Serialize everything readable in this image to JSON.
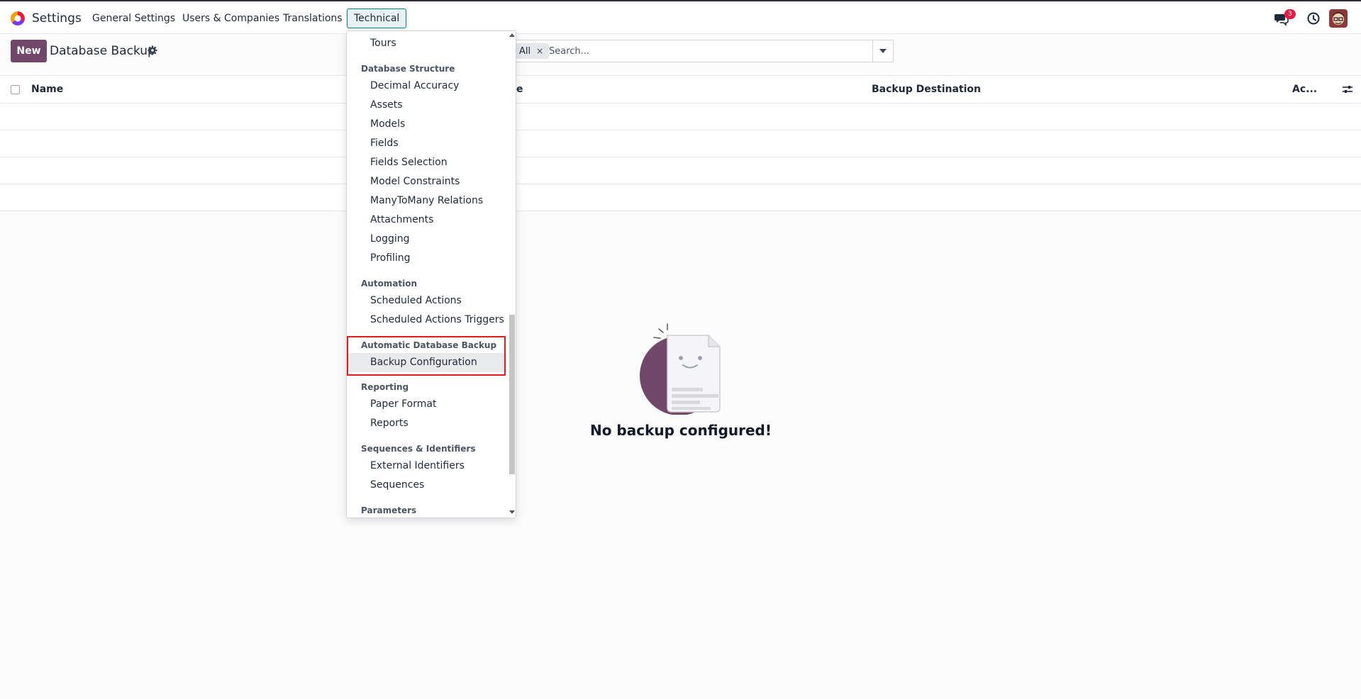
{
  "navbar": {
    "app_title": "Settings",
    "menus": [
      {
        "label": "General Settings"
      },
      {
        "label": "Users & Companies"
      },
      {
        "label": "Translations"
      },
      {
        "label": "Technical"
      }
    ],
    "messages_badge": "3"
  },
  "control_panel": {
    "new_button": "New",
    "page_title": "Database Backup",
    "search": {
      "facet_label": "All",
      "facet_remove": "×",
      "placeholder": "Search..."
    }
  },
  "list": {
    "columns": [
      {
        "label": "Name"
      },
      {
        "label": "ne"
      },
      {
        "label": "Backup Destination"
      },
      {
        "label": "Ac..."
      }
    ]
  },
  "empty_state": {
    "title": "No backup configured!"
  },
  "dropdown": {
    "items": [
      {
        "type": "item",
        "label": "Tours"
      },
      {
        "type": "header",
        "label": "Database Structure"
      },
      {
        "type": "item",
        "label": "Decimal Accuracy"
      },
      {
        "type": "item",
        "label": "Assets"
      },
      {
        "type": "item",
        "label": "Models"
      },
      {
        "type": "item",
        "label": "Fields"
      },
      {
        "type": "item",
        "label": "Fields Selection"
      },
      {
        "type": "item",
        "label": "Model Constraints"
      },
      {
        "type": "item",
        "label": "ManyToMany Relations"
      },
      {
        "type": "item",
        "label": "Attachments"
      },
      {
        "type": "item",
        "label": "Logging"
      },
      {
        "type": "item",
        "label": "Profiling"
      },
      {
        "type": "header",
        "label": "Automation"
      },
      {
        "type": "item",
        "label": "Scheduled Actions"
      },
      {
        "type": "item",
        "label": "Scheduled Actions Triggers"
      },
      {
        "type": "header",
        "label": "Automatic Database Backup"
      },
      {
        "type": "item",
        "label": "Backup Configuration"
      },
      {
        "type": "header",
        "label": "Reporting"
      },
      {
        "type": "item",
        "label": "Paper Format"
      },
      {
        "type": "item",
        "label": "Reports"
      },
      {
        "type": "header",
        "label": "Sequences & Identifiers"
      },
      {
        "type": "item",
        "label": "External Identifiers"
      },
      {
        "type": "item",
        "label": "Sequences"
      },
      {
        "type": "header",
        "label": "Parameters"
      }
    ]
  },
  "colors": {
    "primary": "#71476a",
    "active_menu_border": "#017e84",
    "highlight_box": "#e11d1d",
    "badge": "#e11d48"
  }
}
